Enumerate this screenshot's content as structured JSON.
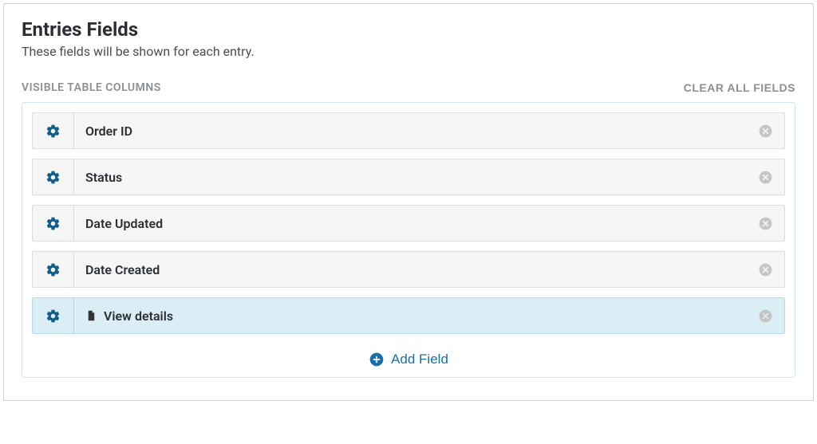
{
  "heading": "Entries Fields",
  "subheading": "These fields will be shown for each entry.",
  "section_title": "VISIBLE TABLE COLUMNS",
  "clear_all": "CLEAR ALL FIELDS",
  "fields": [
    {
      "label": "Order ID",
      "highlighted": false,
      "has_page_icon": false
    },
    {
      "label": "Status",
      "highlighted": false,
      "has_page_icon": false
    },
    {
      "label": "Date Updated",
      "highlighted": false,
      "has_page_icon": false
    },
    {
      "label": "Date Created",
      "highlighted": false,
      "has_page_icon": false
    },
    {
      "label": "View details",
      "highlighted": true,
      "has_page_icon": true
    }
  ],
  "add_field_label": "Add Field"
}
